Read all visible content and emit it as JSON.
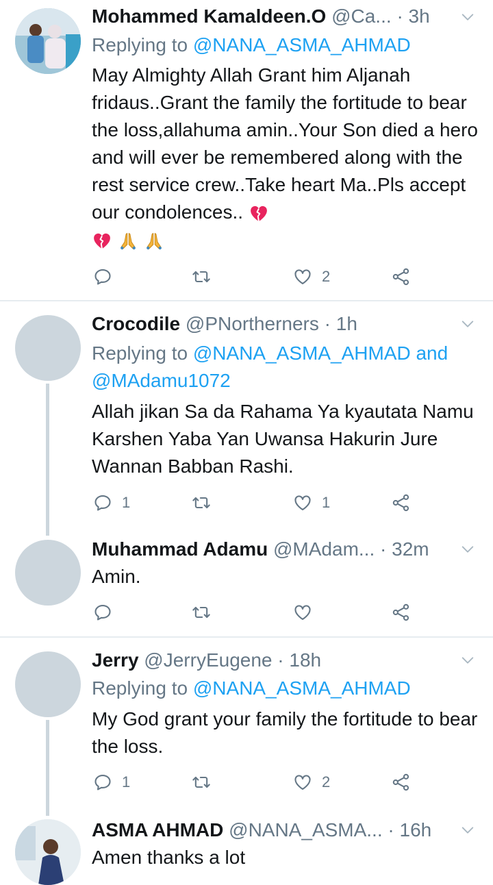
{
  "colors": {
    "text": "#14171a",
    "secondary": "#657786",
    "link": "#1da1f2",
    "divider": "#e6ecf0",
    "placeholder_avatar": "#ccd6dd"
  },
  "tweets": [
    {
      "name": "Mohammed Kamaldeen.O",
      "handle": "@Ca...",
      "dot": "·",
      "time": "3h",
      "reply_prefix": "Replying to ",
      "reply_mention": "@NANA_ASMA_AHMAD",
      "text": "May Almighty Allah Grant him Aljanah fridaus..Grant the family the fortitude to bear the loss,allahuma amin..Your Son died a hero and will ever be remembered along with the rest service crew..Take heart Ma..Pls accept our condolences..",
      "emojis": [
        "broken-heart",
        "broken-heart",
        "folded-hands",
        "folded-hands"
      ],
      "reply_count": "",
      "like_count": "2"
    },
    {
      "name": "Crocodile",
      "handle": "@PNortherners",
      "dot": "·",
      "time": "1h",
      "reply_prefix": "Replying to ",
      "reply_mention": "@NANA_ASMA_AHMAD and @MAdamu1072",
      "text": "Allah jikan Sa da Rahama Ya kyautata Namu Karshen Yaba Yan Uwansa Hakurin Jure Wannan Babban Rashi.",
      "reply_count": "1",
      "like_count": "1"
    },
    {
      "name": "Muhammad Adamu",
      "handle": "@MAdam...",
      "dot": "·",
      "time": "32m",
      "text": "Amin.",
      "reply_count": "",
      "like_count": ""
    },
    {
      "name": "Jerry",
      "handle": "@JerryEugene",
      "dot": "·",
      "time": "18h",
      "reply_prefix": "Replying to ",
      "reply_mention": "@NANA_ASMA_AHMAD",
      "text": "My God grant your family the fortitude to bear the loss.",
      "reply_count": "1",
      "like_count": "2"
    },
    {
      "name": "ASMA AHMAD",
      "handle": "@NANA_ASMA...",
      "dot": "·",
      "time": "16h",
      "text": "Amen thanks a lot"
    }
  ]
}
